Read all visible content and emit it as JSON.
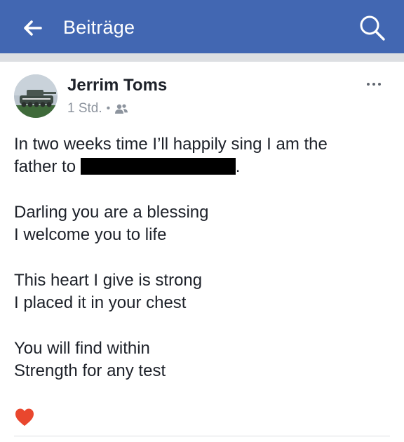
{
  "header": {
    "title": "Beiträge",
    "back_icon": "arrow-left-icon",
    "search_icon": "search-icon",
    "background_color": "#4267b2"
  },
  "post": {
    "author": "Jerrim Toms",
    "timestamp": "1 Std.",
    "separator": "•",
    "privacy_icon": "friends-icon",
    "more_icon": "more-horizontal-icon",
    "body": {
      "p1_line1": "In two weeks time I’ll happily sing I am the",
      "p1_line2_prefix": "father to",
      "p1_line2_suffix": ".",
      "p2_line1": "Darling you are a blessing",
      "p2_line2": "I welcome you to life",
      "p3_line1": "This heart I give is strong",
      "p3_line2": "I placed it in your chest",
      "p4_line1": "You will find within",
      "p4_line2": "Strength for any test"
    },
    "reaction_icon": "heart-icon",
    "reaction_color": "#e9472e"
  }
}
